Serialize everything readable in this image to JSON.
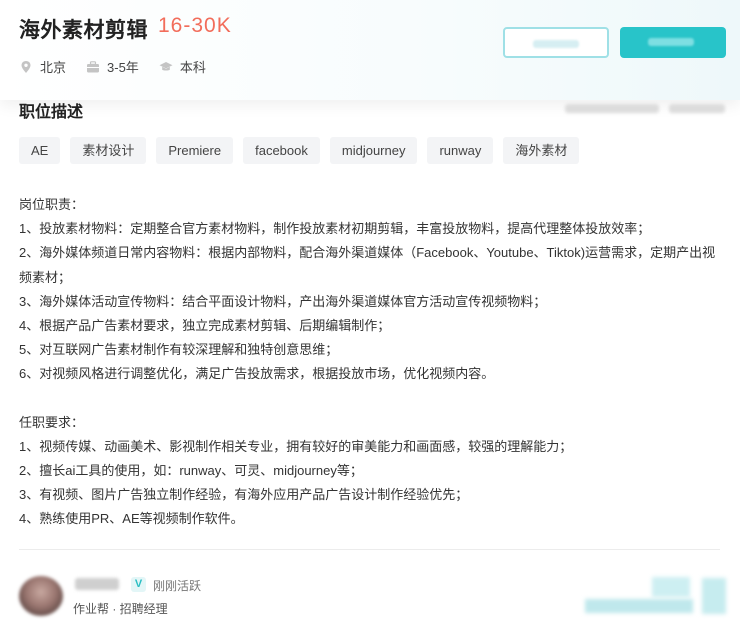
{
  "header": {
    "job_title": "海外素材剪辑",
    "salary": "16-30K",
    "location": "北京",
    "experience": "3-5年",
    "education": "本科",
    "accent_color": "#28c4c9",
    "salary_color": "#f26d5b"
  },
  "section": {
    "title": "职位描述"
  },
  "tags": [
    "AE",
    "素材设计",
    "Premiere",
    "facebook",
    "midjourney",
    "runway",
    "海外素材"
  ],
  "description": {
    "responsibilities_title": "岗位职责：",
    "responsibilities": [
      "1、投放素材物料：定期整合官方素材物料，制作投放素材初期剪辑，丰富投放物料，提高代理整体投放效率；",
      "2、海外媒体频道日常内容物料：根据内部物料，配合海外渠道媒体（Facebook、Youtube、Tiktok)运营需求，定期产出视频素材；",
      "3、海外媒体活动宣传物料：结合平面设计物料，产出海外渠道媒体官方活动宣传视频物料；",
      "4、根据产品广告素材要求，独立完成素材剪辑、后期编辑制作；",
      "5、对互联网广告素材制作有较深理解和独特创意思维；",
      "6、对视频风格进行调整优化，满足广告投放需求，根据投放市场，优化视频内容。"
    ],
    "requirements_title": "任职要求：",
    "requirements": [
      "1、视频传媒、动画美术、影视制作相关专业，拥有较好的审美能力和画面感，较强的理解能力；",
      "2、擅长ai工具的使用，如：runway、可灵、midjourney等；",
      "3、有视频、图片广告独立制作经验，有海外应用产品广告设计制作经验优先；",
      "4、熟练使用PR、AE等视频制作软件。"
    ]
  },
  "recruiter": {
    "verified_badge": "V",
    "active_status": "刚刚活跃",
    "company_role": "作业帮 · 招聘经理"
  },
  "icons": {
    "location": "location-pin-icon",
    "experience": "briefcase-icon",
    "education": "graduation-cap-icon"
  }
}
